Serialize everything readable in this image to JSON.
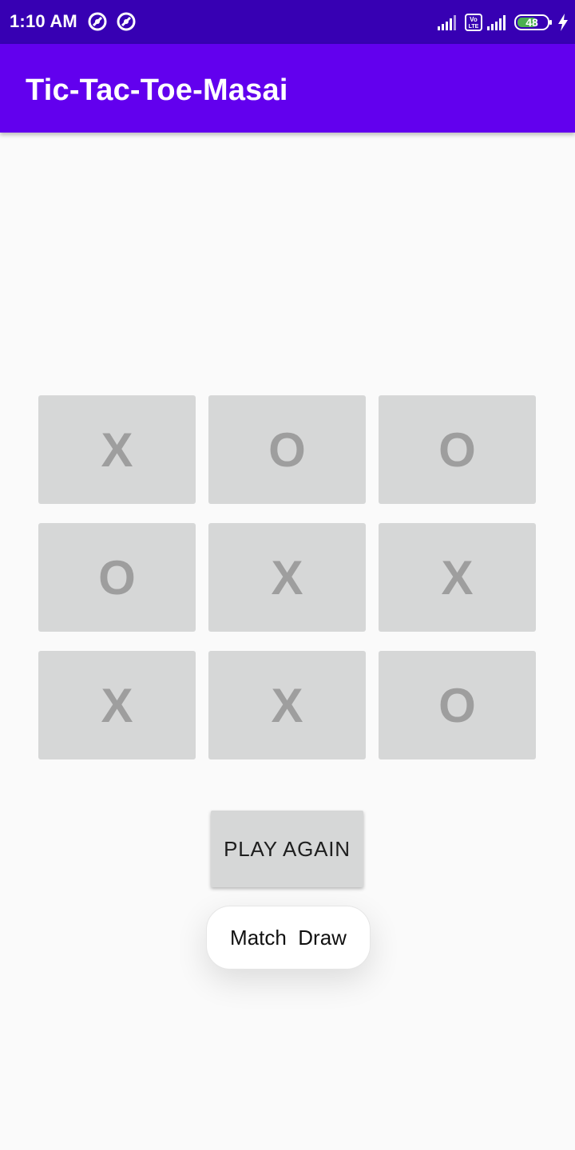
{
  "status_bar": {
    "time": "1:10 AM",
    "battery_level": "48",
    "network_badge": "Vo LTE",
    "icons": [
      "notification-icon",
      "notification-icon",
      "signal-icon",
      "volte-icon",
      "signal-icon",
      "battery-icon",
      "charging-icon"
    ]
  },
  "app_bar": {
    "title": "Tic-Tac-Toe-Masai"
  },
  "board": {
    "cells": [
      "X",
      "O",
      "O",
      "O",
      "X",
      "X",
      "X",
      "X",
      "O"
    ]
  },
  "play_again_label": "PLAY AGAIN",
  "toast_message": "Match  Draw",
  "colors": {
    "status_bar": "#3700b3",
    "app_bar": "#6200ee",
    "cell_background": "#d6d7d7",
    "cell_text": "#9e9e9e"
  }
}
